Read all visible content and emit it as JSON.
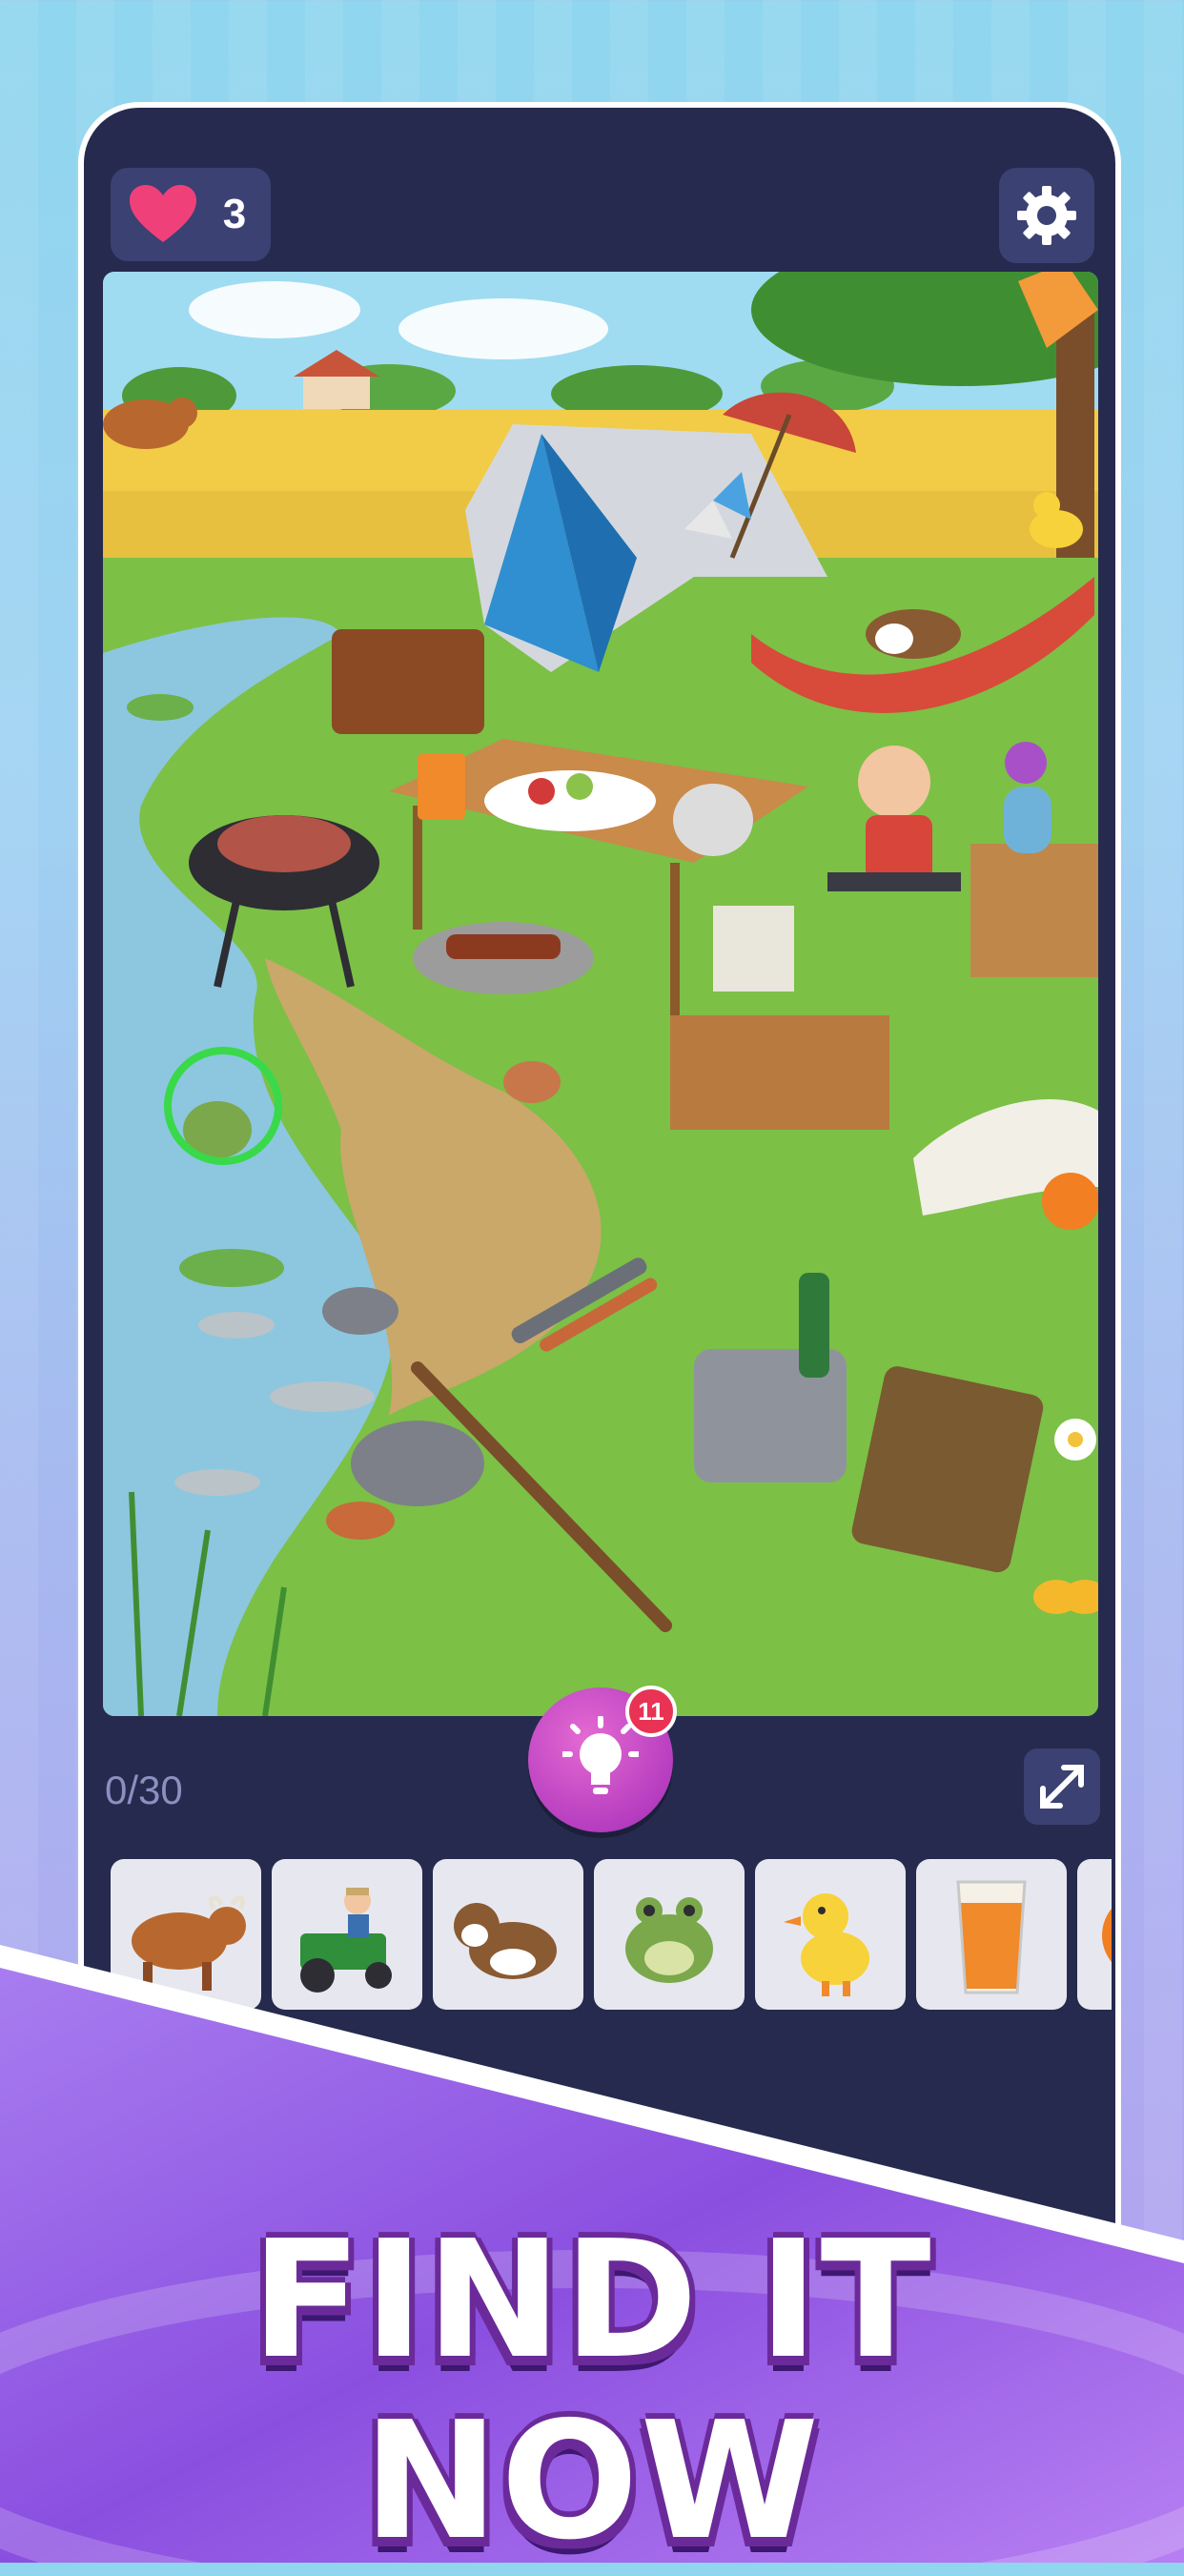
{
  "hud": {
    "lives_icon": "heart-icon",
    "lives": "3",
    "settings_icon": "gear-icon"
  },
  "hint": {
    "icon": "lightbulb-icon",
    "badge": "11"
  },
  "progress": {
    "found_text": "0/30"
  },
  "expand_icon": "expand-icon",
  "items_to_find": [
    {
      "name": "bull-icon"
    },
    {
      "name": "farmer-tractor-icon"
    },
    {
      "name": "dog-icon"
    },
    {
      "name": "frog-icon"
    },
    {
      "name": "duck-icon"
    },
    {
      "name": "orange-juice-icon"
    },
    {
      "name": "orange-icon"
    }
  ],
  "banner": {
    "title": "FIND IT NOW"
  },
  "colors": {
    "panel": "#262a4e",
    "button_bg": "#3b4172",
    "heart": "#f0407a",
    "hint": "#c24ac6",
    "found_ring": "#39d94a",
    "banner": "#8b4fe0"
  }
}
